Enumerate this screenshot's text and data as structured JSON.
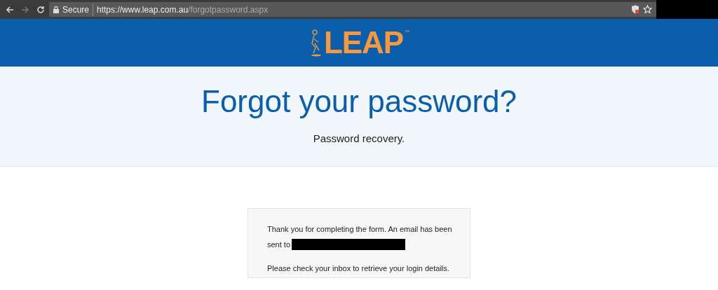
{
  "browser": {
    "security_label": "Secure",
    "url_host": "https://www.leap.com.au",
    "url_path": "/forgotpassword.aspx"
  },
  "header": {
    "logo_text": "LEAP",
    "logo_mark": "™"
  },
  "hero": {
    "title": "Forgot your password?",
    "subtitle": "Password recovery."
  },
  "message": {
    "line_1": "Thank you for completing the form. An email has been",
    "line_2_prefix": "sent to",
    "line_3": "Please check your inbox to retrieve your login details."
  }
}
